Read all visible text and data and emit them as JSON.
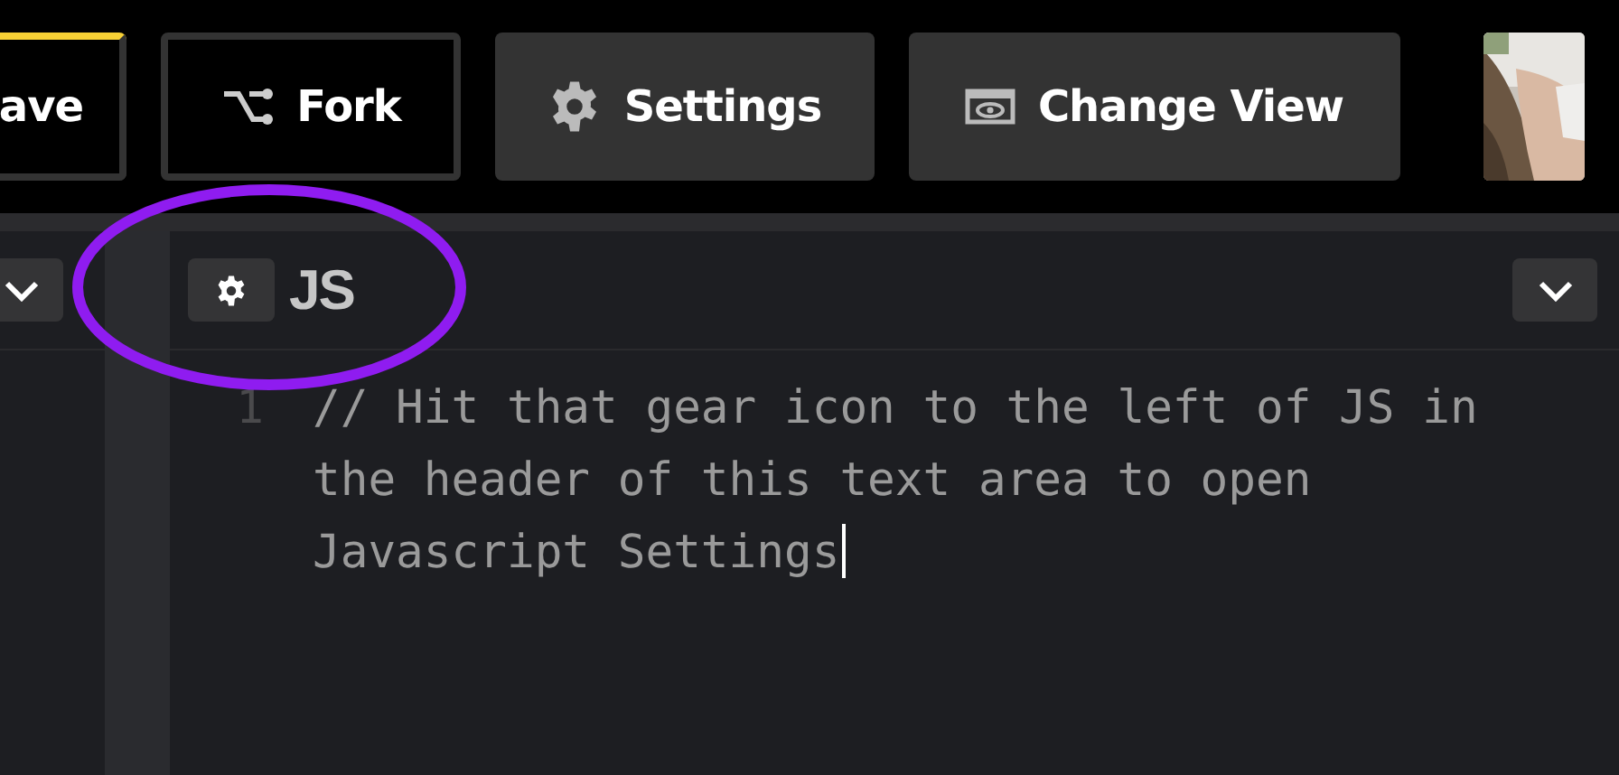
{
  "toolbar": {
    "buttons": [
      {
        "kind": "save",
        "label": "ave"
      },
      {
        "kind": "fork",
        "label": "Fork"
      },
      {
        "kind": "settings",
        "label": "Settings"
      },
      {
        "kind": "view",
        "label": "Change View"
      }
    ]
  },
  "editor": {
    "title": "JS",
    "lines": [
      {
        "number": "1",
        "text": "// Hit that gear icon to the left of JS in the header of this text area to open Javascript Settings"
      }
    ]
  }
}
